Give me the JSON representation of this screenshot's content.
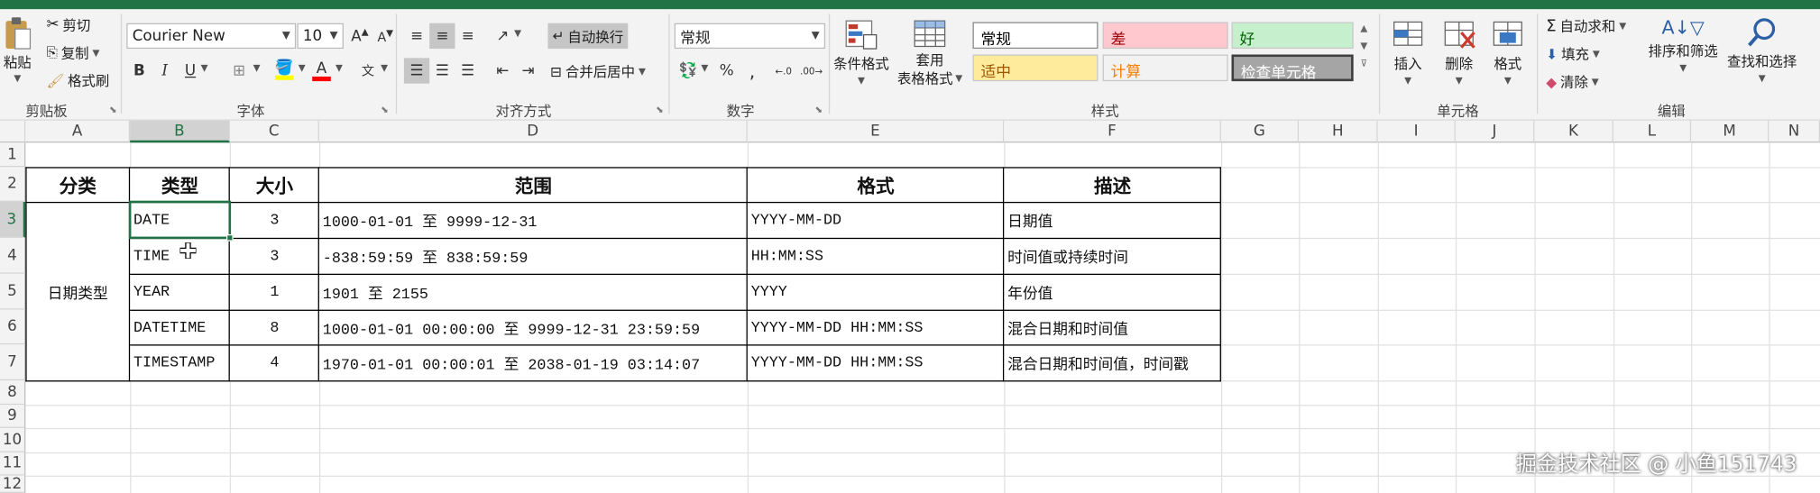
{
  "ribbon": {
    "clipboard": {
      "paste": "粘贴",
      "cut": "剪切",
      "copy": "复制",
      "format_painter": "格式刷",
      "group": "剪贴板"
    },
    "font": {
      "name": "Courier New",
      "size": "10",
      "group": "字体"
    },
    "alignment": {
      "wrap_text": "自动换行",
      "merge_center": "合并后居中",
      "group": "对齐方式"
    },
    "number": {
      "format": "常规",
      "group": "数字"
    },
    "styles_group": {
      "conditional": "条件格式",
      "table_format_1": "套用",
      "table_format_2": "表格格式",
      "group": "样式",
      "cells": [
        {
          "label": "常规",
          "bg": "#ffffff",
          "fg": "#000000"
        },
        {
          "label": "差",
          "bg": "#ffc7ce",
          "fg": "#9c0006"
        },
        {
          "label": "好",
          "bg": "#c6efce",
          "fg": "#006100"
        },
        {
          "label": "适中",
          "bg": "#ffeb9c",
          "fg": "#9c5700"
        },
        {
          "label": "计算",
          "bg": "#f2f2f2",
          "fg": "#fa7d00"
        },
        {
          "label": "检查单元格",
          "bg": "#a5a5a5",
          "fg": "#ffffff"
        }
      ]
    },
    "cells_group": {
      "insert": "插入",
      "delete": "删除",
      "format": "格式",
      "group": "单元格"
    },
    "editing": {
      "autosum": "自动求和",
      "fill": "填充",
      "clear": "清除",
      "sort_filter": "排序和筛选",
      "find_select": "查找和选择",
      "group": "编辑"
    }
  },
  "grid": {
    "columns": [
      "A",
      "B",
      "C",
      "D",
      "E",
      "F",
      "G",
      "H",
      "I",
      "J",
      "K",
      "L",
      "M",
      "N"
    ],
    "rows": [
      "1",
      "2",
      "3",
      "4",
      "5",
      "6",
      "7",
      "8",
      "9",
      "10",
      "11",
      "12"
    ],
    "headers": [
      "分类",
      "类型",
      "大小",
      "范围",
      "格式",
      "描述"
    ],
    "category": "日期类型",
    "data": [
      {
        "type": "DATE",
        "size": "3",
        "range": "1000-01-01 至 9999-12-31",
        "format": "YYYY-MM-DD",
        "desc": "日期值"
      },
      {
        "type": "TIME",
        "size": "3",
        "range": "-838:59:59 至 838:59:59",
        "format": "HH:MM:SS",
        "desc": "时间值或持续时间"
      },
      {
        "type": "YEAR",
        "size": "1",
        "range": "1901 至 2155",
        "format": "YYYY",
        "desc": "年份值"
      },
      {
        "type": "DATETIME",
        "size": "8",
        "range": "1000-01-01 00:00:00 至 9999-12-31 23:59:59",
        "format": "YYYY-MM-DD HH:MM:SS",
        "desc": "混合日期和时间值"
      },
      {
        "type": "TIMESTAMP",
        "size": "4",
        "range": "1970-01-01 00:00:01 至 2038-01-19 03:14:07",
        "format": "YYYY-MM-DD HH:MM:SS",
        "desc": "混合日期和时间值，时间戳"
      }
    ]
  },
  "watermark": "掘金技术社区 @ 小鱼151743"
}
